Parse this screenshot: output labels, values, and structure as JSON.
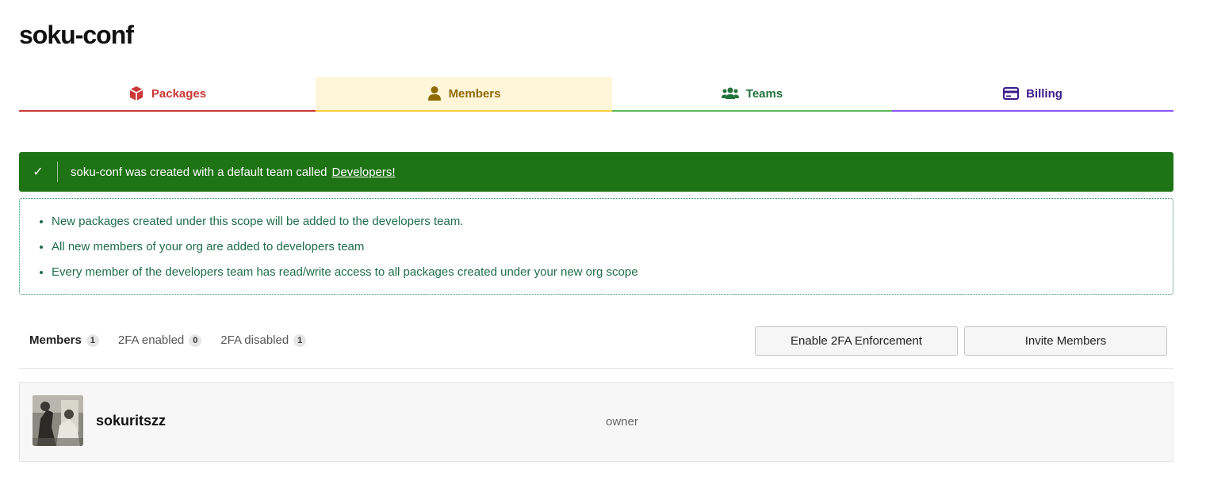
{
  "org": {
    "title": "soku-conf"
  },
  "tabs": [
    {
      "label": "Packages",
      "icon": "package-icon",
      "color": "#cb3837"
    },
    {
      "label": "Members",
      "icon": "user-icon",
      "color": "#8f6a00",
      "active": true
    },
    {
      "label": "Teams",
      "icon": "users-icon",
      "color": "#23733c"
    },
    {
      "label": "Billing",
      "icon": "credit-card-icon",
      "color": "#3b1a8a"
    }
  ],
  "banner": {
    "icon": "check-icon",
    "message": "soku-conf was created with a default team called",
    "link": "Developers!",
    "color": "#1e7314"
  },
  "info": {
    "items": [
      "New packages created under this scope will be added to the developers team.",
      "All new members of your org are added to developers team",
      "Every member of the developers team has read/write access to all packages created under your new org scope"
    ]
  },
  "filters": [
    {
      "label": "Members",
      "count": "1",
      "active": true
    },
    {
      "label": "2FA enabled",
      "count": "0"
    },
    {
      "label": "2FA disabled",
      "count": "1"
    }
  ],
  "actions": {
    "enforce_2fa": "Enable 2FA Enforcement",
    "invite": "Invite Members"
  },
  "members": [
    {
      "name": "sokuritszz",
      "role": "owner",
      "avatar": "avatar-photo"
    }
  ]
}
